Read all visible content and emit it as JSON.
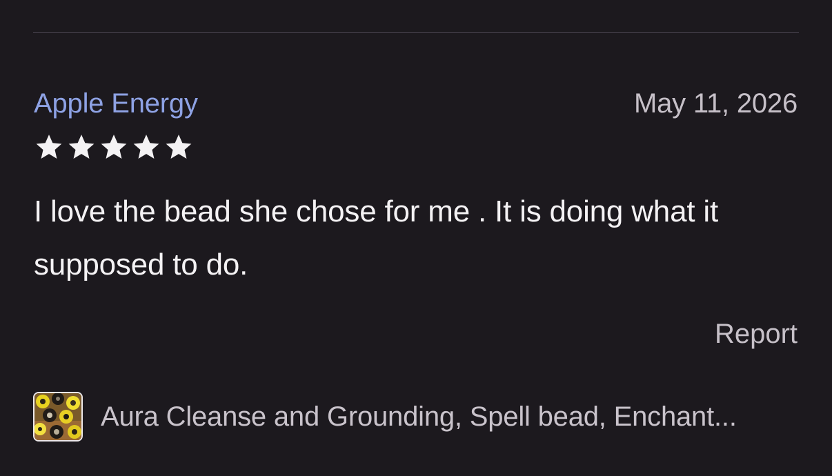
{
  "review": {
    "reviewer_name": "Apple Energy",
    "date": "May 11, 2026",
    "rating": 5,
    "max_rating": 5,
    "text": "I love the bead she chose for me . It is doing what it supposed to do.",
    "report_label": "Report"
  },
  "product": {
    "title": "Aura Cleanse and Grounding, Spell bead, Enchant...",
    "thumbnail_icon": "bead-product-thumbnail"
  },
  "colors": {
    "background": "#1c191e",
    "reviewer_name": "#8ea2e4",
    "secondary_text": "#c6c0c8",
    "body_text": "#f4f2f4",
    "star": "#f4f2f4",
    "divider": "#4a4450"
  }
}
